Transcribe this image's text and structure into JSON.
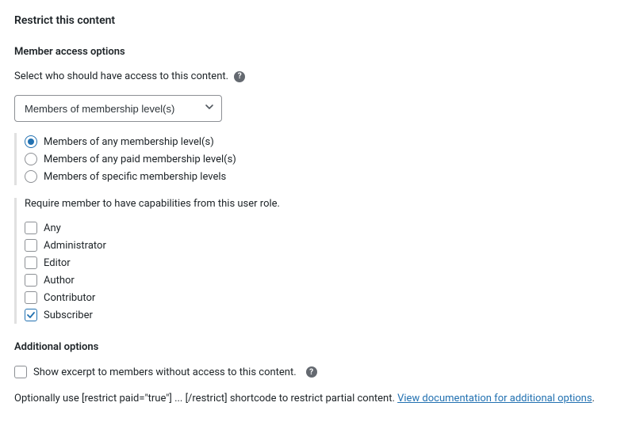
{
  "title": "Restrict this content",
  "memberAccess": {
    "heading": "Member access options",
    "desc": "Select who should have access to this content.",
    "selectValue": "Members of membership level(s)",
    "radios": [
      {
        "label": "Members of any membership level(s)",
        "checked": true
      },
      {
        "label": "Members of any paid membership level(s)",
        "checked": false
      },
      {
        "label": "Members of specific membership levels",
        "checked": false
      }
    ],
    "roleText": "Require member to have capabilities from this user role.",
    "roles": [
      {
        "label": "Any",
        "checked": false
      },
      {
        "label": "Administrator",
        "checked": false
      },
      {
        "label": "Editor",
        "checked": false
      },
      {
        "label": "Author",
        "checked": false
      },
      {
        "label": "Contributor",
        "checked": false
      },
      {
        "label": "Subscriber",
        "checked": true
      }
    ]
  },
  "additional": {
    "heading": "Additional options",
    "excerptLabel": "Show excerpt to members without access to this content.",
    "excerptChecked": false,
    "footerPrefix": "Optionally use [restrict paid=\"true\"] ... [/restrict] shortcode to restrict partial content. ",
    "footerLink": "View documentation for additional options",
    "footerSuffix": "."
  }
}
